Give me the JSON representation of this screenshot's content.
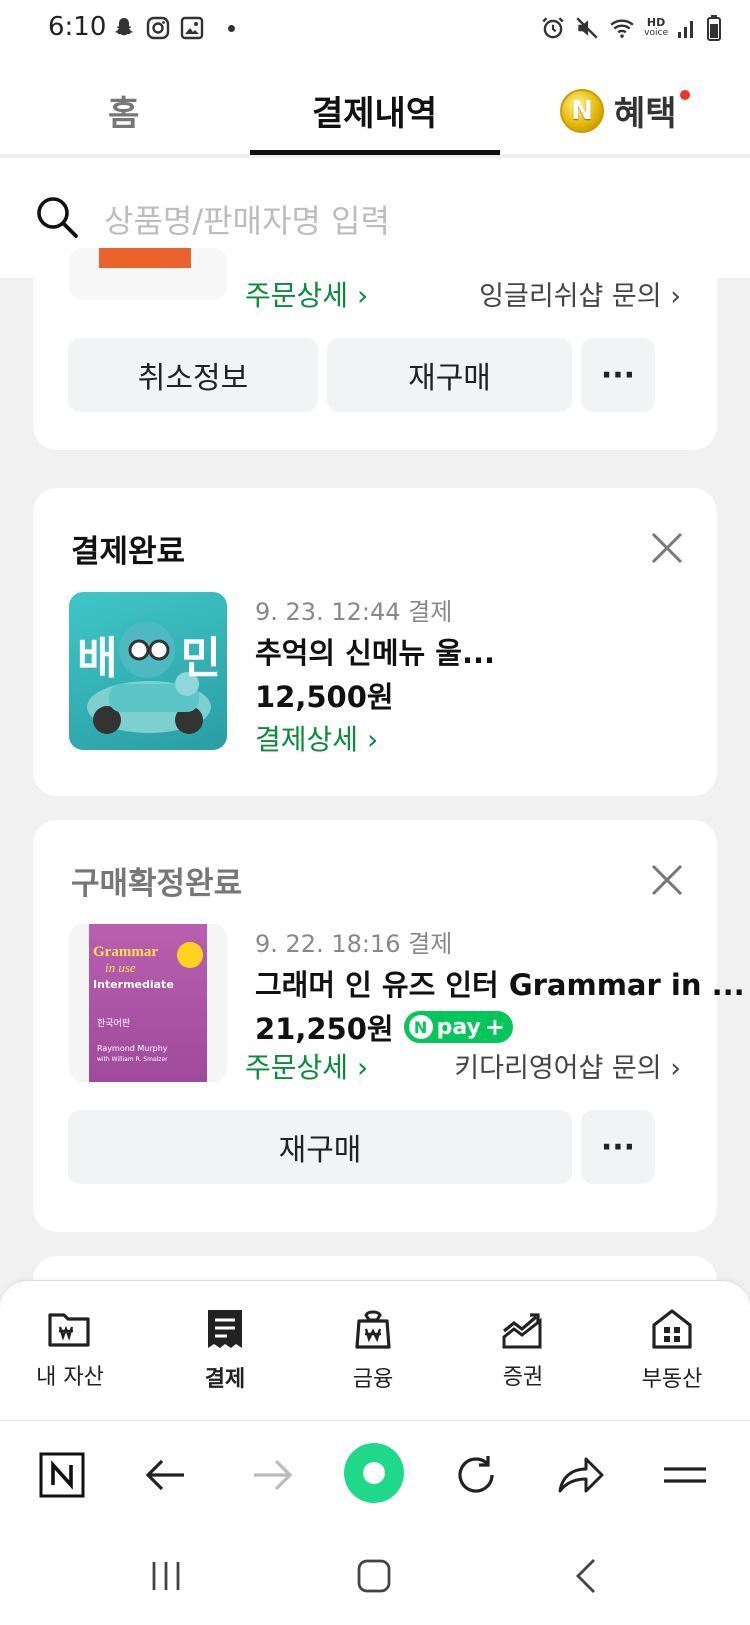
{
  "status_bar": {
    "time": "6:10",
    "hd_voice_top": "HD",
    "hd_voice_bottom": "voice"
  },
  "tabs": {
    "home": "홈",
    "payments": "결제내역",
    "benefits": "혜택",
    "coin_letter": "N"
  },
  "search": {
    "placeholder": "상품명/판매자명 입력"
  },
  "card1": {
    "order_detail": "주문상세",
    "store_inquiry": "잉글리쉬샵 문의",
    "cancel_info": "취소정보",
    "repurchase": "재구매",
    "more": "···"
  },
  "card2": {
    "status": "결제완료",
    "date": "9. 23. 12:44 결제",
    "product": "추억의 신메뉴 울...",
    "price": "12,500원",
    "payment_detail": "결제상세",
    "thumb_text_left": "배",
    "thumb_text_right": "민"
  },
  "card3": {
    "status": "구매확정완료",
    "date": "9. 22. 18:16 결제",
    "product": "그래머 인 유즈 인터 Grammar in ...",
    "price": "21,250원",
    "npay": "pay",
    "order_detail": "주문상세",
    "store_inquiry": "키다리영어샵 문의",
    "repurchase": "재구매",
    "more": "···",
    "book_title_1": "Grammar",
    "book_title_2": "in use",
    "book_title_3": "Intermediate",
    "book_korean": "한국어판",
    "book_author": "Raymond Murphy",
    "book_author2": "with William R. Smalzer"
  },
  "bottom_nav": [
    {
      "label": "내 자산"
    },
    {
      "label": "결제"
    },
    {
      "label": "금융"
    },
    {
      "label": "증권"
    },
    {
      "label": "부동산"
    }
  ],
  "colors": {
    "green": "#0a8a3a",
    "npay_green": "#03c75a",
    "card_bg": "#ffffff",
    "page_bg": "#f1f1f1"
  }
}
